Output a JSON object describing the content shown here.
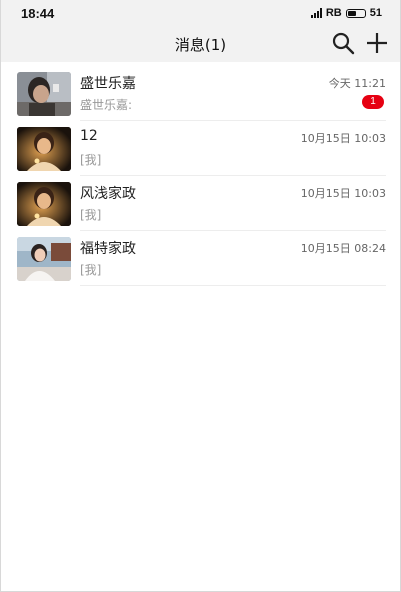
{
  "status_bar": {
    "time": "18:44",
    "network": "RB",
    "battery": "51",
    "battery_level": 0.51
  },
  "header": {
    "title": "消息(1)",
    "actions": [
      {
        "icon": "search-icon"
      },
      {
        "icon": "plus-icon"
      }
    ]
  },
  "conversations": [
    {
      "name": "盛世乐嘉",
      "time": "今天 11:21",
      "preview": "盛世乐嘉:",
      "badge": "1",
      "avatar": "man-portrait"
    },
    {
      "name": "12",
      "time": "10月15日 10:03",
      "preview": "[我]",
      "badge": "",
      "avatar": "woman-candle-portrait"
    },
    {
      "name": "风浅家政",
      "time": "10月15日 10:03",
      "preview": "[我]",
      "badge": "",
      "avatar": "woman-candle-portrait"
    },
    {
      "name": "福特家政",
      "time": "10月15日 08:24",
      "preview": "[我]",
      "badge": "",
      "avatar": "woman-outdoor-portrait"
    }
  ],
  "colors": {
    "header_bg": "#f2f2f2",
    "badge": "#e60012",
    "divider": "#ededed"
  }
}
